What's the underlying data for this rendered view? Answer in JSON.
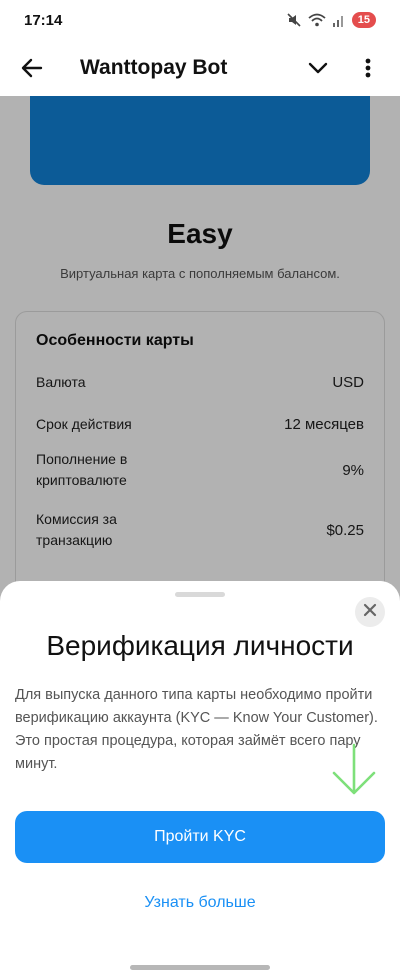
{
  "status_bar": {
    "time": "17:14",
    "battery": "15",
    "icons": [
      "mute-icon",
      "wifi-icon",
      "signal-icon"
    ]
  },
  "app_bar": {
    "title": "Wanttopay Bot",
    "icons": [
      "back-arrow-icon",
      "chevron-down-icon",
      "more-vertical-icon"
    ]
  },
  "page": {
    "card_color": "#1283d9",
    "tariff_name": "Easy",
    "tariff_description": "Виртуальная карта с пополняемым балансом.",
    "features": {
      "title": "Особенности карты",
      "rows": [
        {
          "label": "Валюта",
          "value": "USD"
        },
        {
          "label": "Срок действия",
          "value": "12 месяцев"
        },
        {
          "label": "Пополнение в криптовалюте",
          "value": "9%"
        },
        {
          "label": "Комиссия за транзакцию",
          "value": "$0.25"
        }
      ]
    }
  },
  "sheet": {
    "title": "Верификация личности",
    "body": "Для выпуска данного типа карты необходимо пройти верификацию аккаунта (KYC — Know Your Customer). Это простая процедура, которая займёт всего пару минут.",
    "primary_button": "Пройти KYC",
    "secondary_link": "Узнать больше",
    "accent_color": "#1a90f5",
    "annotation_arrow_color": "#7ee07a"
  }
}
